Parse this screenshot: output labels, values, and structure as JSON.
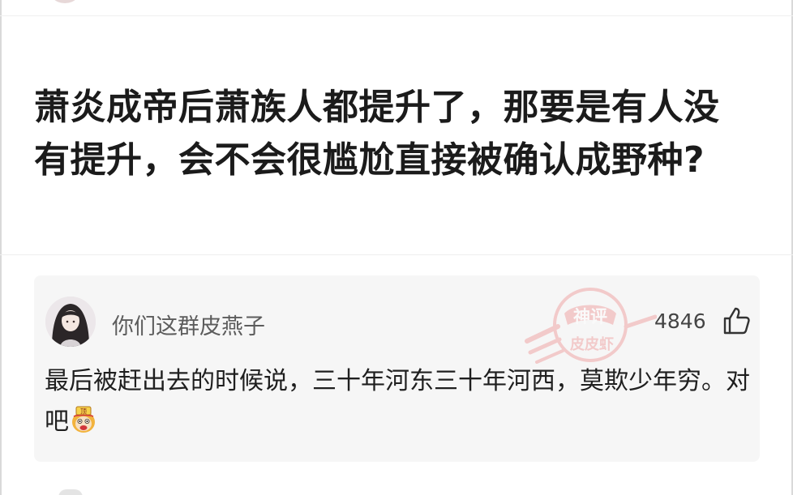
{
  "post": {
    "title": "萧炎成帝后萧族人都提升了，那要是有人没有提升，会不会很尴尬直接被确认成野种?"
  },
  "comment": {
    "username": "你们这群皮燕子",
    "likes": "4846",
    "text": "最后被赶出去的时候说，三十年河东三十年河西，莫欺少年穷。对吧"
  },
  "watermark": {
    "line1": "神评",
    "line2": "皮皮虾"
  },
  "icons": {
    "like": "thumbs-up-icon",
    "emoji": "monkey-king-emoji-icon"
  },
  "colors": {
    "card_bg": "#f6f6f6",
    "watermark": "#f0a7a7",
    "title": "#1b1b1b",
    "username": "#5c5c5c"
  }
}
